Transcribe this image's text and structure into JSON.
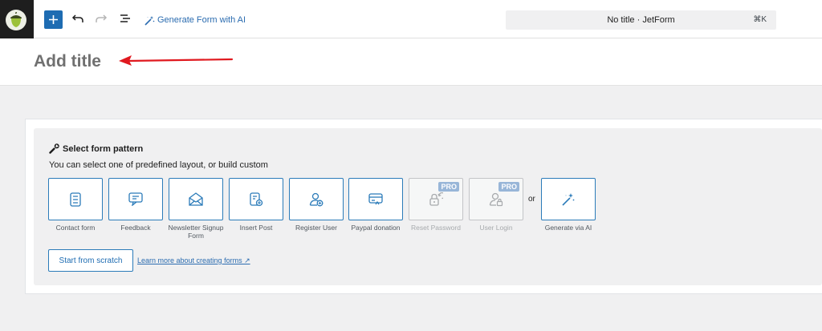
{
  "toolbar": {
    "generate_ai_label": "Generate Form with AI",
    "document_title": "No title · JetForm",
    "shortcut": "⌘K"
  },
  "title": {
    "placeholder": "Add title"
  },
  "pattern_panel": {
    "heading": "Select form pattern",
    "description": "You can select one of predefined layout, or build custom",
    "patterns": [
      {
        "label": "Contact form",
        "icon": "contact-form-icon",
        "pro": false
      },
      {
        "label": "Feedback",
        "icon": "feedback-icon",
        "pro": false
      },
      {
        "label": "Newsletter Signup Form",
        "icon": "newsletter-icon",
        "pro": false
      },
      {
        "label": "Insert Post",
        "icon": "insert-post-icon",
        "pro": false
      },
      {
        "label": "Register User",
        "icon": "register-user-icon",
        "pro": false
      },
      {
        "label": "Paypal donation",
        "icon": "paypal-icon",
        "pro": false
      },
      {
        "label": "Reset Password",
        "icon": "reset-password-icon",
        "pro": true
      },
      {
        "label": "User Login",
        "icon": "user-login-icon",
        "pro": true
      }
    ],
    "or_label": "or",
    "generate_ai": {
      "label": "Generate via AI",
      "icon": "magic-wand-icon"
    },
    "pro_badge": "PRO",
    "start_scratch_label": "Start from scratch",
    "learn_more_label": "Learn more about creating forms ↗"
  },
  "colors": {
    "accent": "#1e6cb2",
    "annotation_arrow": "#e0191f"
  }
}
